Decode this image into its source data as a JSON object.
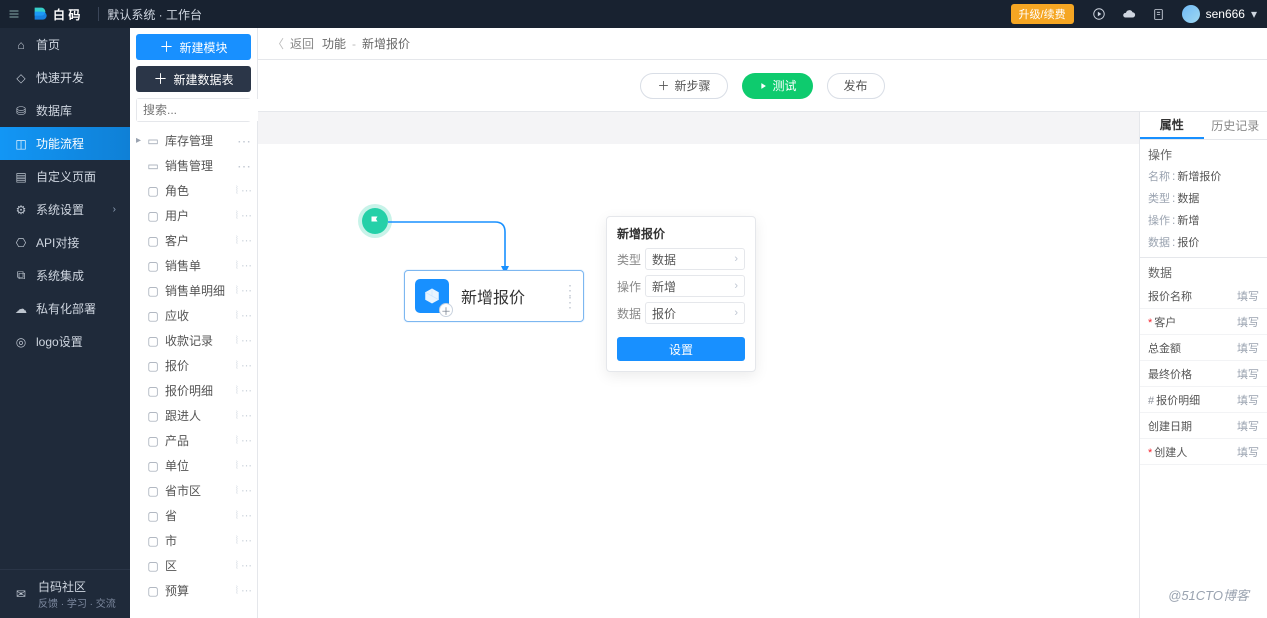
{
  "topbar": {
    "brand": "白 码",
    "workspace": "默认系统 · 工作台",
    "upgrade_badge": "升级/续费",
    "user": "sen666"
  },
  "nav": {
    "items": [
      {
        "label": "首页"
      },
      {
        "label": "快速开发"
      },
      {
        "label": "数据库"
      },
      {
        "label": "功能流程",
        "active": true
      },
      {
        "label": "自定义页面"
      },
      {
        "label": "系统设置",
        "chev": true
      },
      {
        "label": "API对接"
      },
      {
        "label": "系统集成"
      },
      {
        "label": "私有化部署"
      },
      {
        "label": "logo设置"
      }
    ],
    "community_title": "白码社区",
    "community_sub": "反馈 · 学习 · 交流"
  },
  "col2": {
    "new_module": "新建模块",
    "new_table": "新建数据表",
    "search_placeholder": "搜索...",
    "tree": [
      {
        "type": "folder",
        "label": "库存管理",
        "caret": true
      },
      {
        "type": "folder",
        "label": "销售管理"
      },
      {
        "type": "doc",
        "label": "角色"
      },
      {
        "type": "doc",
        "label": "用户"
      },
      {
        "type": "doc",
        "label": "客户"
      },
      {
        "type": "doc",
        "label": "销售单"
      },
      {
        "type": "doc",
        "label": "销售单明细"
      },
      {
        "type": "doc",
        "label": "应收"
      },
      {
        "type": "doc",
        "label": "收款记录"
      },
      {
        "type": "doc",
        "label": "报价"
      },
      {
        "type": "doc",
        "label": "报价明细"
      },
      {
        "type": "doc",
        "label": "跟进人"
      },
      {
        "type": "doc",
        "label": "产品"
      },
      {
        "type": "doc",
        "label": "单位"
      },
      {
        "type": "doc",
        "label": "省市区"
      },
      {
        "type": "doc",
        "label": "省"
      },
      {
        "type": "doc",
        "label": "市"
      },
      {
        "type": "doc",
        "label": "区"
      },
      {
        "type": "doc",
        "label": "预算"
      }
    ]
  },
  "crumb": {
    "back": "返回",
    "section": "功能",
    "page": "新增报价"
  },
  "toolbar": {
    "new_step": "新步骤",
    "test": "测试",
    "publish": "发布"
  },
  "node": {
    "title": "新增报价"
  },
  "popover": {
    "title": "新增报价",
    "rows": [
      {
        "label": "类型",
        "value": "数据"
      },
      {
        "label": "操作",
        "value": "新增"
      },
      {
        "label": "数据",
        "value": "报价"
      }
    ],
    "set_btn": "设置"
  },
  "rpanel": {
    "tabs": [
      "属性",
      "历史记录"
    ],
    "op_section": "操作",
    "kv": [
      {
        "k": "名称",
        "v": "新增报价"
      },
      {
        "k": "类型",
        "v": "数据"
      },
      {
        "k": "操作",
        "v": "新增"
      },
      {
        "k": "数据",
        "v": "报价"
      }
    ],
    "data_section": "数据",
    "fields": [
      {
        "label": "报价名称",
        "v": "填写"
      },
      {
        "label": "客户",
        "v": "填写",
        "req": true
      },
      {
        "label": "总金额",
        "v": "填写"
      },
      {
        "label": "最终价格",
        "v": "填写"
      },
      {
        "label": "报价明细",
        "v": "填写",
        "hash": true
      },
      {
        "label": "创建日期",
        "v": "填写"
      },
      {
        "label": "创建人",
        "v": "填写",
        "req": true
      }
    ]
  },
  "watermark": "@51CTO博客"
}
